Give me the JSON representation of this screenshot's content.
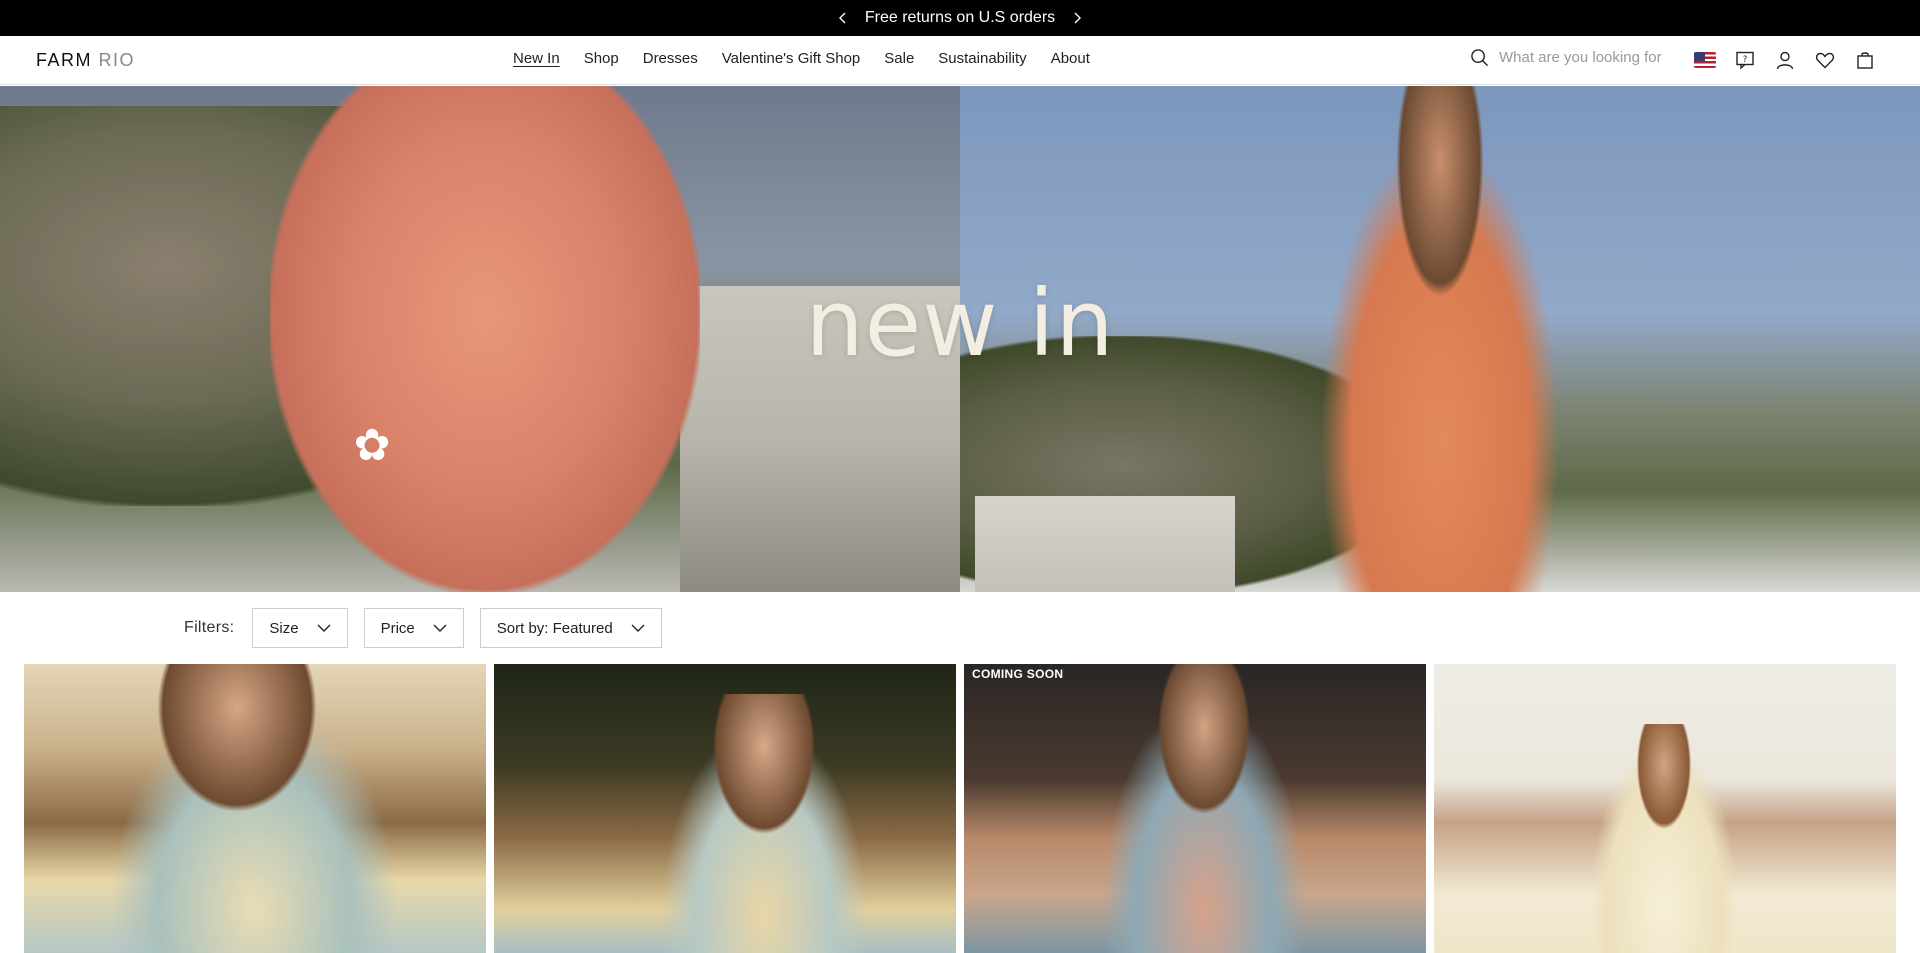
{
  "announcement": {
    "text": "Free returns on U.S orders"
  },
  "header": {
    "logo_main": "FARM",
    "logo_sub": "RIO",
    "nav": [
      {
        "label": "New In",
        "active": true
      },
      {
        "label": "Shop"
      },
      {
        "label": "Dresses"
      },
      {
        "label": "Valentine's Gift Shop"
      },
      {
        "label": "Sale"
      },
      {
        "label": "Sustainability"
      },
      {
        "label": "About"
      }
    ],
    "search": {
      "placeholder": "What are you looking for"
    },
    "icons": [
      "us-flag-icon",
      "help-chat-icon",
      "account-icon",
      "wishlist-heart-icon",
      "shopping-bag-icon"
    ]
  },
  "hero": {
    "title": "new in"
  },
  "filters": {
    "label": "Filters:",
    "size_label": "Size",
    "price_label": "Price",
    "sort_label": "Sort by: Featured"
  },
  "products": [
    {
      "badge": ""
    },
    {
      "badge": ""
    },
    {
      "badge": "COMING SOON"
    },
    {
      "badge": ""
    }
  ],
  "colors": {
    "announcement_bg": "#000000",
    "hero_title": "#f3ede2"
  }
}
